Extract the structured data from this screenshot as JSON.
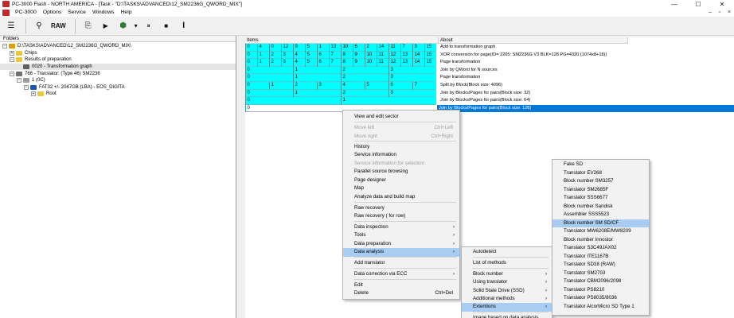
{
  "window": {
    "title": "PC-3000 Flash - NORTH AMERICA - [Task - \"D:\\TASKS\\ADVANCED\\12_SM2236G_QWORD_MIX\"]",
    "controls": {
      "minimize": "—",
      "maximize": "☐",
      "close": "✕"
    }
  },
  "menubar": {
    "items": [
      "PC-3000",
      "Options",
      "Service",
      "Windows",
      "Help"
    ],
    "mdi": {
      "minimize": "–",
      "restore": "▫",
      "close": "×"
    }
  },
  "toolbar": {
    "raw_label": "RAW",
    "icons": [
      "log-icon",
      "binoculars-icon",
      "raw-button",
      "export-icon",
      "play-icon",
      "device-icon",
      "pause-icon",
      "stop-icon",
      "text-cursor-icon"
    ],
    "glyphs": {
      "log": "☰",
      "binoculars": "⚲",
      "export": "⎘",
      "play": "▶",
      "device": "⬢",
      "dropdown": "▾",
      "pause": "⏸",
      "stop": "■",
      "cursor": "𝐈"
    }
  },
  "folders": {
    "header": "Folders",
    "tree": [
      {
        "label": "D:\\TASKS\\ADVANCED\\12_SM2236G_QWORD_MIX\\",
        "indent": 0,
        "expander": "−",
        "icon_color": "#e0a000"
      },
      {
        "label": "Chips",
        "indent": 1,
        "expander": "+",
        "icon_color": "#e8c840"
      },
      {
        "label": "Results of preparation",
        "indent": 1,
        "expander": "−",
        "icon_color": "#e8c840"
      },
      {
        "label": "0020 - Transformation graph",
        "indent": 2,
        "expander": "",
        "icon_color": "#606060",
        "selected": true
      },
      {
        "label": "766 - Translator: (Type 46) SM2236",
        "indent": 1,
        "expander": "−",
        "icon_color": "#707070"
      },
      {
        "label": "1 (0C)",
        "indent": 2,
        "expander": "−",
        "icon_color": "#9a9a9a"
      },
      {
        "label": "FAT32 +/- 2047GB (LBA) - EOS_DIGITA",
        "indent": 3,
        "expander": "−",
        "icon_color": "#1a56b0"
      },
      {
        "label": "Root",
        "indent": 4,
        "expander": "+",
        "icon_color": "#e8c840"
      }
    ]
  },
  "items_panel": {
    "headers": {
      "items": "Items",
      "about": "About"
    },
    "rows": [
      {
        "cells": [
          "0",
          "4",
          "0",
          "12",
          "9",
          "5",
          "1",
          "13",
          "10",
          "6",
          "2",
          "14",
          "11",
          "7",
          "3",
          "15"
        ],
        "about": "Add to transformation graph"
      },
      {
        "cells": [
          "0",
          "1",
          "2",
          "3",
          "4",
          "5",
          "6",
          "7",
          "8",
          "9",
          "10",
          "11",
          "12",
          "13",
          "14",
          "15"
        ],
        "about": "XOR conversion for page(ID= 2205: SM2236G V3 BLK=128 PG=4320 (1074x8+18))"
      },
      {
        "cells": [
          "0",
          "1",
          "2",
          "3",
          "4",
          "5",
          "6",
          "7",
          "8",
          "9",
          "10",
          "11",
          "12",
          "13",
          "14",
          "15"
        ],
        "about": "Page transformation"
      },
      {
        "cells": [
          "0",
          "",
          "",
          "",
          "1",
          "",
          "",
          "",
          "2",
          "",
          "",
          "",
          "3",
          "",
          "",
          ""
        ],
        "about": "Join by QWord for N sources"
      },
      {
        "cells": [
          "0",
          "",
          "",
          "",
          "1",
          "",
          "",
          "",
          "2",
          "",
          "",
          "",
          "3",
          "",
          "",
          ""
        ],
        "about": "Page transformation"
      },
      {
        "cells": [
          "0",
          "",
          "1",
          "",
          "2",
          "",
          "3",
          "",
          "4",
          "",
          "5",
          "",
          "6",
          "",
          "7",
          ""
        ],
        "about": "Split by Block(Block size: 4096)"
      },
      {
        "cells": [
          "0",
          "",
          "",
          "",
          "1",
          "",
          "",
          "",
          "2",
          "",
          "",
          "",
          "3",
          "",
          "",
          ""
        ],
        "about": "Join by Blocks/Pages for pairs(Block size: 32)"
      },
      {
        "cells": [
          "0",
          "",
          "",
          "",
          "",
          "",
          "",
          "",
          "1",
          "",
          "",
          "",
          "",
          "",
          "",
          ""
        ],
        "about": "Join by Blocks/Pages for pairs(Block size: 64)"
      },
      {
        "cells": [
          "0",
          "",
          "",
          "",
          "",
          "",
          "",
          "",
          "",
          "",
          "",
          "",
          "",
          "",
          "",
          ""
        ],
        "about": "Join by Blocks/Pages for pairs(Block size: 128)",
        "selected": true
      }
    ]
  },
  "context_menu": {
    "items": [
      {
        "label": "View and edit sector",
        "shortcut": "",
        "submenu": false,
        "disabled": false
      },
      {
        "label": "Move left",
        "shortcut": "Ctrl+Left",
        "submenu": false,
        "disabled": true
      },
      {
        "label": "Move right",
        "shortcut": "Ctrl+Right",
        "submenu": false,
        "disabled": true
      },
      {
        "label": "History",
        "shortcut": "",
        "submenu": false,
        "disabled": false
      },
      {
        "label": "Service information",
        "shortcut": "",
        "submenu": false,
        "disabled": false
      },
      {
        "label": "Service information for selection",
        "shortcut": "",
        "submenu": false,
        "disabled": true
      },
      {
        "label": "Parallel source browsing",
        "shortcut": "",
        "submenu": false,
        "disabled": false
      },
      {
        "label": "Page designer",
        "shortcut": "",
        "submenu": false,
        "disabled": false
      },
      {
        "label": "Map",
        "shortcut": "",
        "submenu": false,
        "disabled": false
      },
      {
        "label": "Analyze data and build map",
        "shortcut": "",
        "submenu": false,
        "disabled": false
      },
      {
        "label": "Raw recovery",
        "shortcut": "",
        "submenu": false,
        "disabled": false
      },
      {
        "label": "Raw recovery ( for row)",
        "shortcut": "",
        "submenu": false,
        "disabled": false
      },
      {
        "label": "Data inspection",
        "shortcut": "",
        "submenu": true,
        "disabled": false
      },
      {
        "label": "Tools",
        "shortcut": "",
        "submenu": true,
        "disabled": false
      },
      {
        "label": "Data preparation",
        "shortcut": "",
        "submenu": true,
        "disabled": false
      },
      {
        "label": "Data analysis",
        "shortcut": "",
        "submenu": true,
        "disabled": false,
        "highlighted": true
      },
      {
        "label": "Add translator",
        "shortcut": "",
        "submenu": false,
        "disabled": false
      },
      {
        "label": "Data correction via ECC",
        "shortcut": "",
        "submenu": true,
        "disabled": false
      },
      {
        "label": "Edit",
        "shortcut": "",
        "submenu": false,
        "disabled": false
      },
      {
        "label": "Delete",
        "shortcut": "Ctrl+Del",
        "submenu": false,
        "disabled": false
      }
    ]
  },
  "analysis_submenu": {
    "items": [
      {
        "label": "Autodetect",
        "submenu": false
      },
      {
        "label": "List of methods",
        "submenu": false
      },
      {
        "label": "Block number",
        "submenu": true
      },
      {
        "label": "Using translator",
        "submenu": true
      },
      {
        "label": "Solid State Drive (SSD)",
        "submenu": true
      },
      {
        "label": "Additional methods",
        "submenu": true
      },
      {
        "label": "Extentions",
        "submenu": true,
        "highlighted": true
      },
      {
        "label": "Image based on data analysis",
        "submenu": false
      }
    ]
  },
  "extensions_submenu": {
    "items": [
      "Fake SD",
      "Translator EV268",
      "Block number SM3257",
      "Translator SM2685F",
      "Translator SSS6677",
      "Block number Sandisk",
      "Assembler SSS5523",
      "Block number SM SD/CF",
      "Translator MW6208E/MW8209",
      "Block number Innostor",
      "Translator S3C49JAX02",
      "Translator ITE1167B",
      "Translator SD18 (RAW)",
      "Translator SM2703",
      "Translator CBM2096/2098",
      "Translator PS8210",
      "Translator PS8035/8036",
      "Translator AlcorMicro SD Type 1"
    ],
    "highlighted_index": 7
  },
  "colors": {
    "cyan_fill": "#00ffff",
    "selection_blue": "#0078d7",
    "menu_highlight": "#a9cdf2"
  }
}
